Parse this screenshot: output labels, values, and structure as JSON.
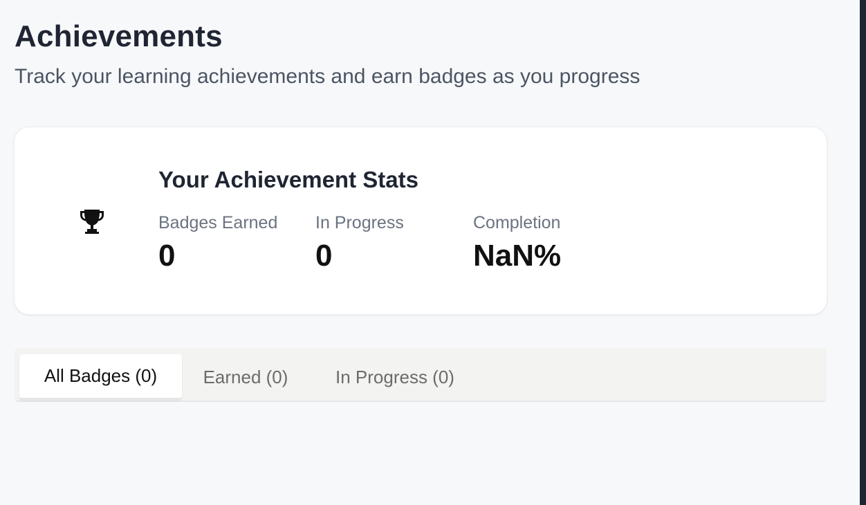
{
  "header": {
    "title": "Achievements",
    "subtitle": "Track your learning achievements and earn badges as you progress"
  },
  "stats": {
    "icon": "trophy-icon",
    "heading": "Your Achievement Stats",
    "items": [
      {
        "label": "Badges Earned",
        "value": "0"
      },
      {
        "label": "In Progress",
        "value": "0"
      },
      {
        "label": "Completion",
        "value": "NaN%"
      }
    ]
  },
  "tabs": [
    {
      "label": "All Badges (0)",
      "active": true
    },
    {
      "label": "Earned (0)",
      "active": false
    },
    {
      "label": "In Progress (0)",
      "active": false
    }
  ],
  "colors": {
    "background": "#f7f8fa",
    "card": "#ffffff",
    "text_primary": "#1f2532",
    "text_muted": "#6b7280"
  }
}
